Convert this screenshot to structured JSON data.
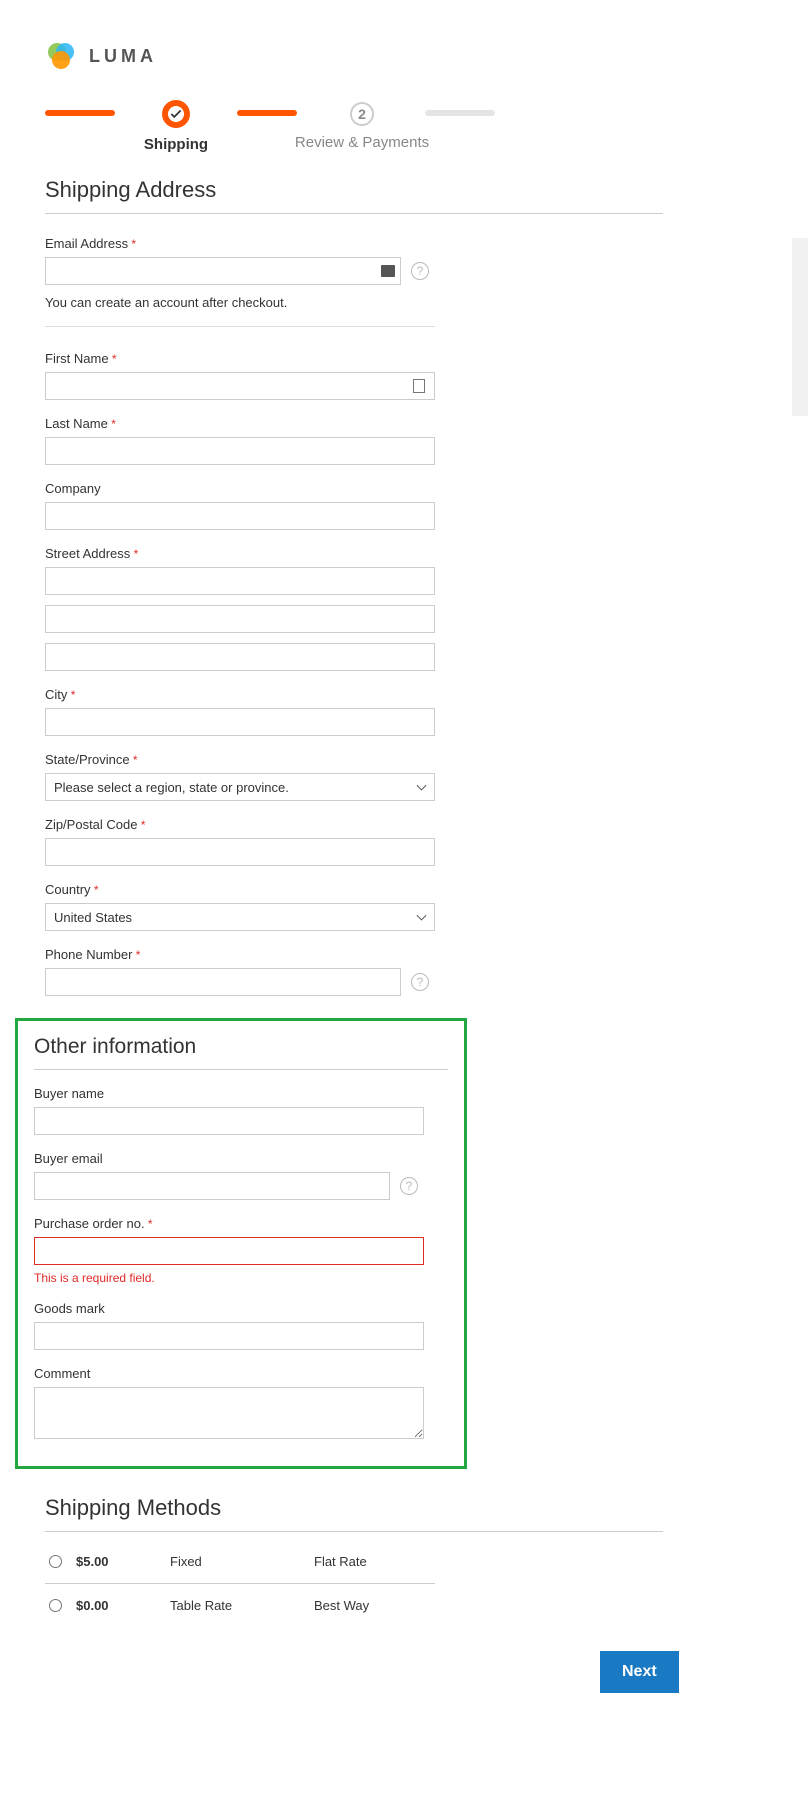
{
  "brand": "LUMA",
  "progress": {
    "step1": {
      "label": "Shipping"
    },
    "step2": {
      "num": "2",
      "label": "Review & Payments"
    }
  },
  "shipping": {
    "title": "Shipping Address",
    "email": {
      "label": "Email Address",
      "hint": "You can create an account after checkout."
    },
    "first_name": {
      "label": "First Name"
    },
    "last_name": {
      "label": "Last Name"
    },
    "company": {
      "label": "Company"
    },
    "street": {
      "label": "Street Address"
    },
    "city": {
      "label": "City"
    },
    "state": {
      "label": "State/Province",
      "placeholder": "Please select a region, state or province."
    },
    "zip": {
      "label": "Zip/Postal Code"
    },
    "country": {
      "label": "Country",
      "value": "United States"
    },
    "phone": {
      "label": "Phone Number"
    }
  },
  "other": {
    "title": "Other information",
    "buyer_name": {
      "label": "Buyer name"
    },
    "buyer_email": {
      "label": "Buyer email"
    },
    "po": {
      "label": "Purchase order no.",
      "error": "This is a required field."
    },
    "goods_mark": {
      "label": "Goods mark"
    },
    "comment": {
      "label": "Comment"
    }
  },
  "methods": {
    "title": "Shipping Methods",
    "rows": [
      {
        "price": "$5.00",
        "type": "Fixed",
        "carrier": "Flat Rate"
      },
      {
        "price": "$0.00",
        "type": "Table Rate",
        "carrier": "Best Way"
      }
    ]
  },
  "next": "Next"
}
